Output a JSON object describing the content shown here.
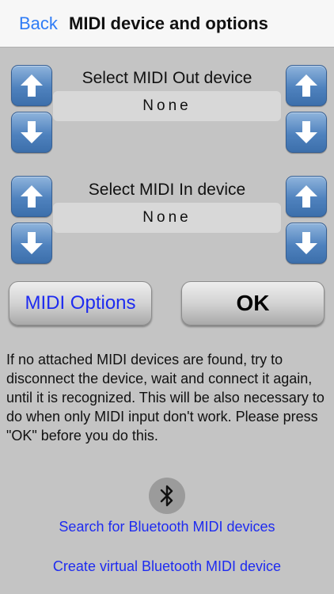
{
  "nav": {
    "back_label": "Back",
    "title": "MIDI device and options"
  },
  "midi_out": {
    "label": "Select MIDI Out device",
    "value": "None"
  },
  "midi_in": {
    "label": "Select MIDI In device",
    "value": "None"
  },
  "buttons": {
    "options_label": "MIDI Options",
    "ok_label": "OK"
  },
  "info_text": "If no attached MIDI devices are found, try to disconnect the device, wait and connect it again, until it is recognized. This will be also necessary to do when only MIDI input don't work. Please press \"OK\" before you do this.",
  "bluetooth": {
    "icon": "bluetooth-icon",
    "search_label": "Search for Bluetooth MIDI devices",
    "virtual_label": "Create virtual Bluetooth MIDI device"
  },
  "colors": {
    "accent_blue": "#1e2bf0",
    "nav_blue": "#2f7cf6",
    "arrow_button": "#4f82be",
    "background": "#c4c4c4"
  }
}
